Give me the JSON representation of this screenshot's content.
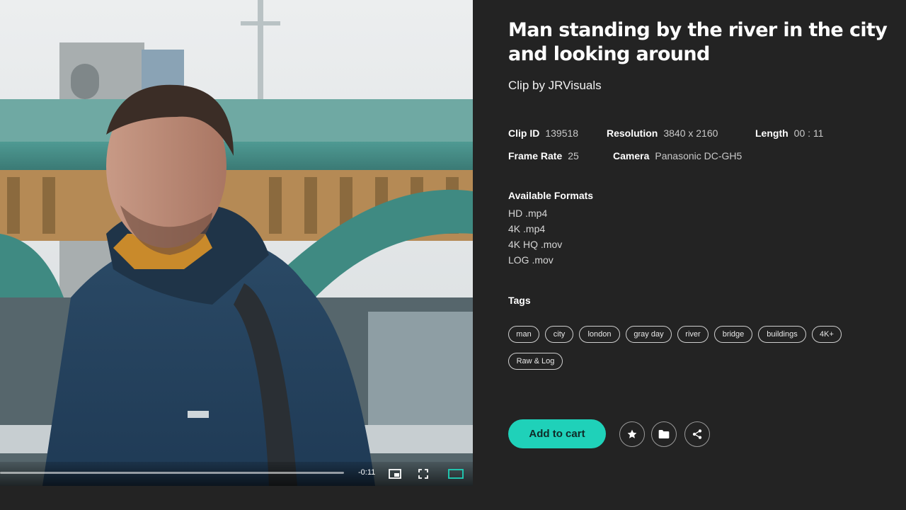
{
  "clip": {
    "title": "Man standing by the river in the city and looking around",
    "byline": "Clip by JRVisuals"
  },
  "meta": {
    "clip_id_label": "Clip ID",
    "clip_id": "139518",
    "resolution_label": "Resolution",
    "resolution": "3840 x 2160",
    "length_label": "Length",
    "length": "00 : 11",
    "frame_rate_label": "Frame Rate",
    "frame_rate": "25",
    "camera_label": "Camera",
    "camera": "Panasonic DC-GH5"
  },
  "formats": {
    "heading": "Available Formats",
    "items": [
      "HD .mp4",
      "4K .mp4",
      "4K HQ .mov",
      "LOG .mov"
    ]
  },
  "tags": {
    "heading": "Tags",
    "items": [
      "man",
      "city",
      "london",
      "gray day",
      "river",
      "bridge",
      "buildings",
      "4K+",
      "Raw & Log"
    ]
  },
  "player": {
    "time_remaining": "-0:11",
    "progress": 0.0,
    "accent_color": "#1fd1b9"
  },
  "actions": {
    "add_to_cart": "Add to cart",
    "icons": [
      "star-icon",
      "folder-icon",
      "share-icon"
    ]
  },
  "colors": {
    "background": "#232323",
    "accent": "#1fd1b9"
  }
}
